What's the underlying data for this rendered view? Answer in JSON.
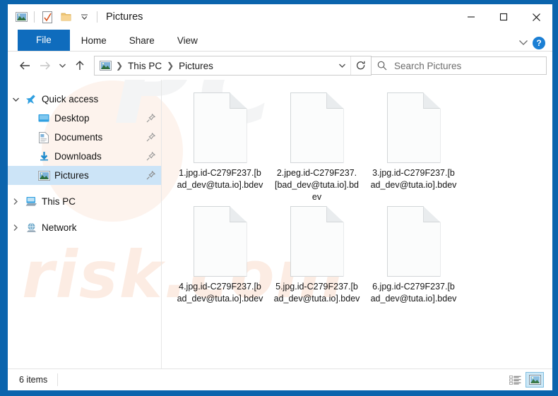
{
  "window": {
    "title": "Pictures",
    "accent_color": "#0b64ad",
    "file_tab_color": "#0f6cbd",
    "selection_color": "#cce4f7",
    "quick_access_toolbar": [
      {
        "name": "pictures-icon",
        "label": "Pictures"
      },
      {
        "name": "properties-icon",
        "label": "Properties"
      },
      {
        "name": "new-folder-icon",
        "label": "New folder"
      },
      {
        "name": "chevron-down-icon",
        "label": "Customize Quick Access Toolbar"
      }
    ],
    "controls": {
      "minimize": "Minimize",
      "maximize": "Maximize",
      "close": "Close"
    }
  },
  "ribbon": {
    "tabs": [
      {
        "label": "File",
        "active": true
      },
      {
        "label": "Home",
        "active": false
      },
      {
        "label": "Share",
        "active": false
      },
      {
        "label": "View",
        "active": false
      }
    ],
    "collapse_label": "Minimize the Ribbon",
    "help_label": "?"
  },
  "address_bar": {
    "back_label": "Back",
    "forward_label": "Forward",
    "recent_label": "Recent locations",
    "up_label": "Up",
    "breadcrumb": [
      {
        "label": "This PC"
      },
      {
        "label": "Pictures"
      }
    ],
    "breadcrumb_dropdown_label": "Previous locations",
    "refresh_label": "Refresh Pictures"
  },
  "search": {
    "placeholder": "Search Pictures",
    "icon": "search-icon"
  },
  "nav_pane": {
    "items": [
      {
        "label": "Quick access",
        "icon": "star-icon",
        "twisty": "expanded",
        "indent": false,
        "selected": false,
        "pinned": false
      },
      {
        "label": "Desktop",
        "icon": "desktop-icon",
        "twisty": "none",
        "indent": true,
        "selected": false,
        "pinned": true
      },
      {
        "label": "Documents",
        "icon": "documents-icon",
        "twisty": "none",
        "indent": true,
        "selected": false,
        "pinned": true
      },
      {
        "label": "Downloads",
        "icon": "downloads-icon",
        "twisty": "none",
        "indent": true,
        "selected": false,
        "pinned": true
      },
      {
        "label": "Pictures",
        "icon": "pictures-icon",
        "twisty": "none",
        "indent": true,
        "selected": true,
        "pinned": true
      },
      {
        "label": "This PC",
        "icon": "this-pc-icon",
        "twisty": "collapsed",
        "indent": false,
        "selected": false,
        "pinned": false
      },
      {
        "label": "Network",
        "icon": "network-icon",
        "twisty": "collapsed",
        "indent": false,
        "selected": false,
        "pinned": false
      }
    ]
  },
  "files": [
    {
      "name": "1.jpg.id-C279F237.[bad_dev@tuta.io].bdev",
      "icon": "blank-document-icon"
    },
    {
      "name": "2.jpeg.id-C279F237.[bad_dev@tuta.io].bdev",
      "icon": "blank-document-icon"
    },
    {
      "name": "3.jpg.id-C279F237.[bad_dev@tuta.io].bdev",
      "icon": "blank-document-icon"
    },
    {
      "name": "4.jpg.id-C279F237.[bad_dev@tuta.io].bdev",
      "icon": "blank-document-icon"
    },
    {
      "name": "5.jpg.id-C279F237.[bad_dev@tuta.io].bdev",
      "icon": "blank-document-icon"
    },
    {
      "name": "6.jpg.id-C279F237.[bad_dev@tuta.io].bdev",
      "icon": "blank-document-icon"
    }
  ],
  "status_bar": {
    "item_count_text": "6 items",
    "details_view_label": "Details view",
    "large_icons_view_label": "Large icons view",
    "active_view": "large-icons"
  },
  "watermark": {
    "text": "risk.com",
    "big": "PC"
  }
}
